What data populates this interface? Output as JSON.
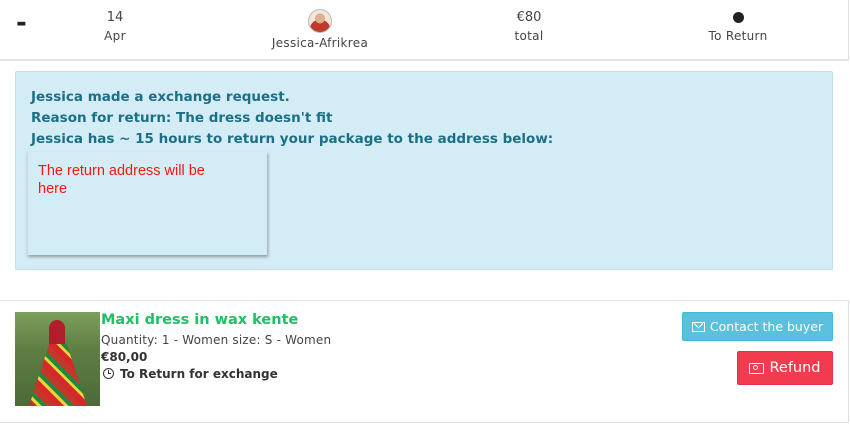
{
  "order_summary": {
    "toggle": "-",
    "date": {
      "day": "14",
      "month": "Apr"
    },
    "buyer": {
      "name": "Jessica-Afrikrea"
    },
    "total": {
      "amount": "€80",
      "label": "total"
    },
    "status": {
      "label": "To Return"
    }
  },
  "return_notice": {
    "request_line": "Jessica made a exchange request.",
    "reason_line": "Reason for return: The dress doesn't fit",
    "deadline_line": "Jessica has ~ 15 hours to return your package to the address below:",
    "address_placeholder": "The return address will be here"
  },
  "product": {
    "title": "Maxi dress in wax kente",
    "details": "Quantity: 1 - Women size: S - Women",
    "price": "€80,00",
    "status": "To Return for exchange"
  },
  "actions": {
    "contact_label": "Contact the buyer",
    "refund_label": "Refund"
  },
  "colors": {
    "product_title": "#1fbf63",
    "alert_bg": "#d4ecf6",
    "alert_text": "#1c6f87",
    "address_text": "#ff1414",
    "contact_button": "#5bc0de",
    "refund_button": "#f23b4f"
  },
  "icons": {
    "status": "clock-icon",
    "contact": "envelope-icon",
    "refund": "money-bill-icon"
  }
}
